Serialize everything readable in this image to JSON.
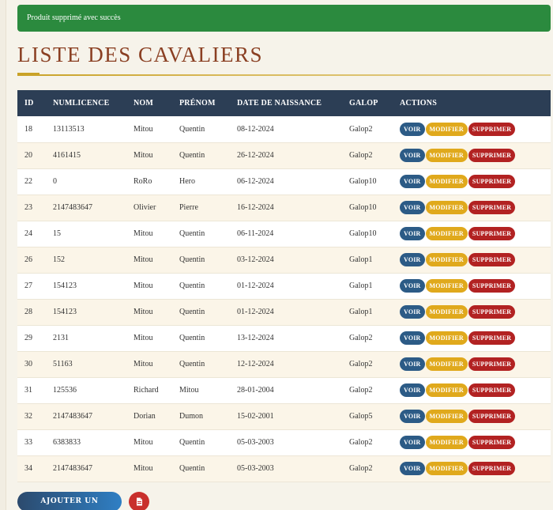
{
  "alert": {
    "message": "Produit supprimé avec succès"
  },
  "page": {
    "title": "LISTE DES CAVALIERS"
  },
  "table": {
    "headers": [
      "ID",
      "NUMLICENCE",
      "NOM",
      "PRÉNOM",
      "DATE DE NAISSANCE",
      "GALOP",
      "ACTIONS"
    ],
    "actions": {
      "view": "VOIR",
      "edit": "MODIFIER",
      "delete": "SUPPRIMER"
    },
    "rows": [
      {
        "id": "18",
        "numlicence": "13113513",
        "nom": "Mitou",
        "prenom": "Quentin",
        "date": "08-12-2024",
        "galop": "Galop2"
      },
      {
        "id": "20",
        "numlicence": "4161415",
        "nom": "Mitou",
        "prenom": "Quentin",
        "date": "26-12-2024",
        "galop": "Galop2"
      },
      {
        "id": "22",
        "numlicence": "0",
        "nom": "RoRo",
        "prenom": "Hero",
        "date": "06-12-2024",
        "galop": "Galop10"
      },
      {
        "id": "23",
        "numlicence": "2147483647",
        "nom": "Olivier",
        "prenom": "Pierre",
        "date": "16-12-2024",
        "galop": "Galop10"
      },
      {
        "id": "24",
        "numlicence": "15",
        "nom": "Mitou",
        "prenom": "Quentin",
        "date": "06-11-2024",
        "galop": "Galop10"
      },
      {
        "id": "26",
        "numlicence": "152",
        "nom": "Mitou",
        "prenom": "Quentin",
        "date": "03-12-2024",
        "galop": "Galop1"
      },
      {
        "id": "27",
        "numlicence": "154123",
        "nom": "Mitou",
        "prenom": "Quentin",
        "date": "01-12-2024",
        "galop": "Galop1"
      },
      {
        "id": "28",
        "numlicence": "154123",
        "nom": "Mitou",
        "prenom": "Quentin",
        "date": "01-12-2024",
        "galop": "Galop1"
      },
      {
        "id": "29",
        "numlicence": "2131",
        "nom": "Mitou",
        "prenom": "Quentin",
        "date": "13-12-2024",
        "galop": "Galop2"
      },
      {
        "id": "30",
        "numlicence": "51163",
        "nom": "Mitou",
        "prenom": "Quentin",
        "date": "12-12-2024",
        "galop": "Galop2"
      },
      {
        "id": "31",
        "numlicence": "125536",
        "nom": "Richard",
        "prenom": "Mitou",
        "date": "28-01-2004",
        "galop": "Galop2"
      },
      {
        "id": "32",
        "numlicence": "2147483647",
        "nom": "Dorian",
        "prenom": "Dumon",
        "date": "15-02-2001",
        "galop": "Galop5"
      },
      {
        "id": "33",
        "numlicence": "6383833",
        "nom": "Mitou",
        "prenom": "Quentin",
        "date": "05-03-2003",
        "galop": "Galop2"
      },
      {
        "id": "34",
        "numlicence": "2147483647",
        "nom": "Mitou",
        "prenom": "Quentin",
        "date": "05-03-2003",
        "galop": "Galop2"
      }
    ]
  },
  "footer": {
    "add_label": "AJOUTER UN CAVALIER",
    "pdf_icon": "pdf-file-icon"
  },
  "colors": {
    "alert": "#2b8a3e",
    "title": "#8a3f22",
    "header": "#2c3e55",
    "view": "#2c5b86",
    "edit": "#e0a91c",
    "delete": "#b22222",
    "pdf": "#c9302c"
  }
}
